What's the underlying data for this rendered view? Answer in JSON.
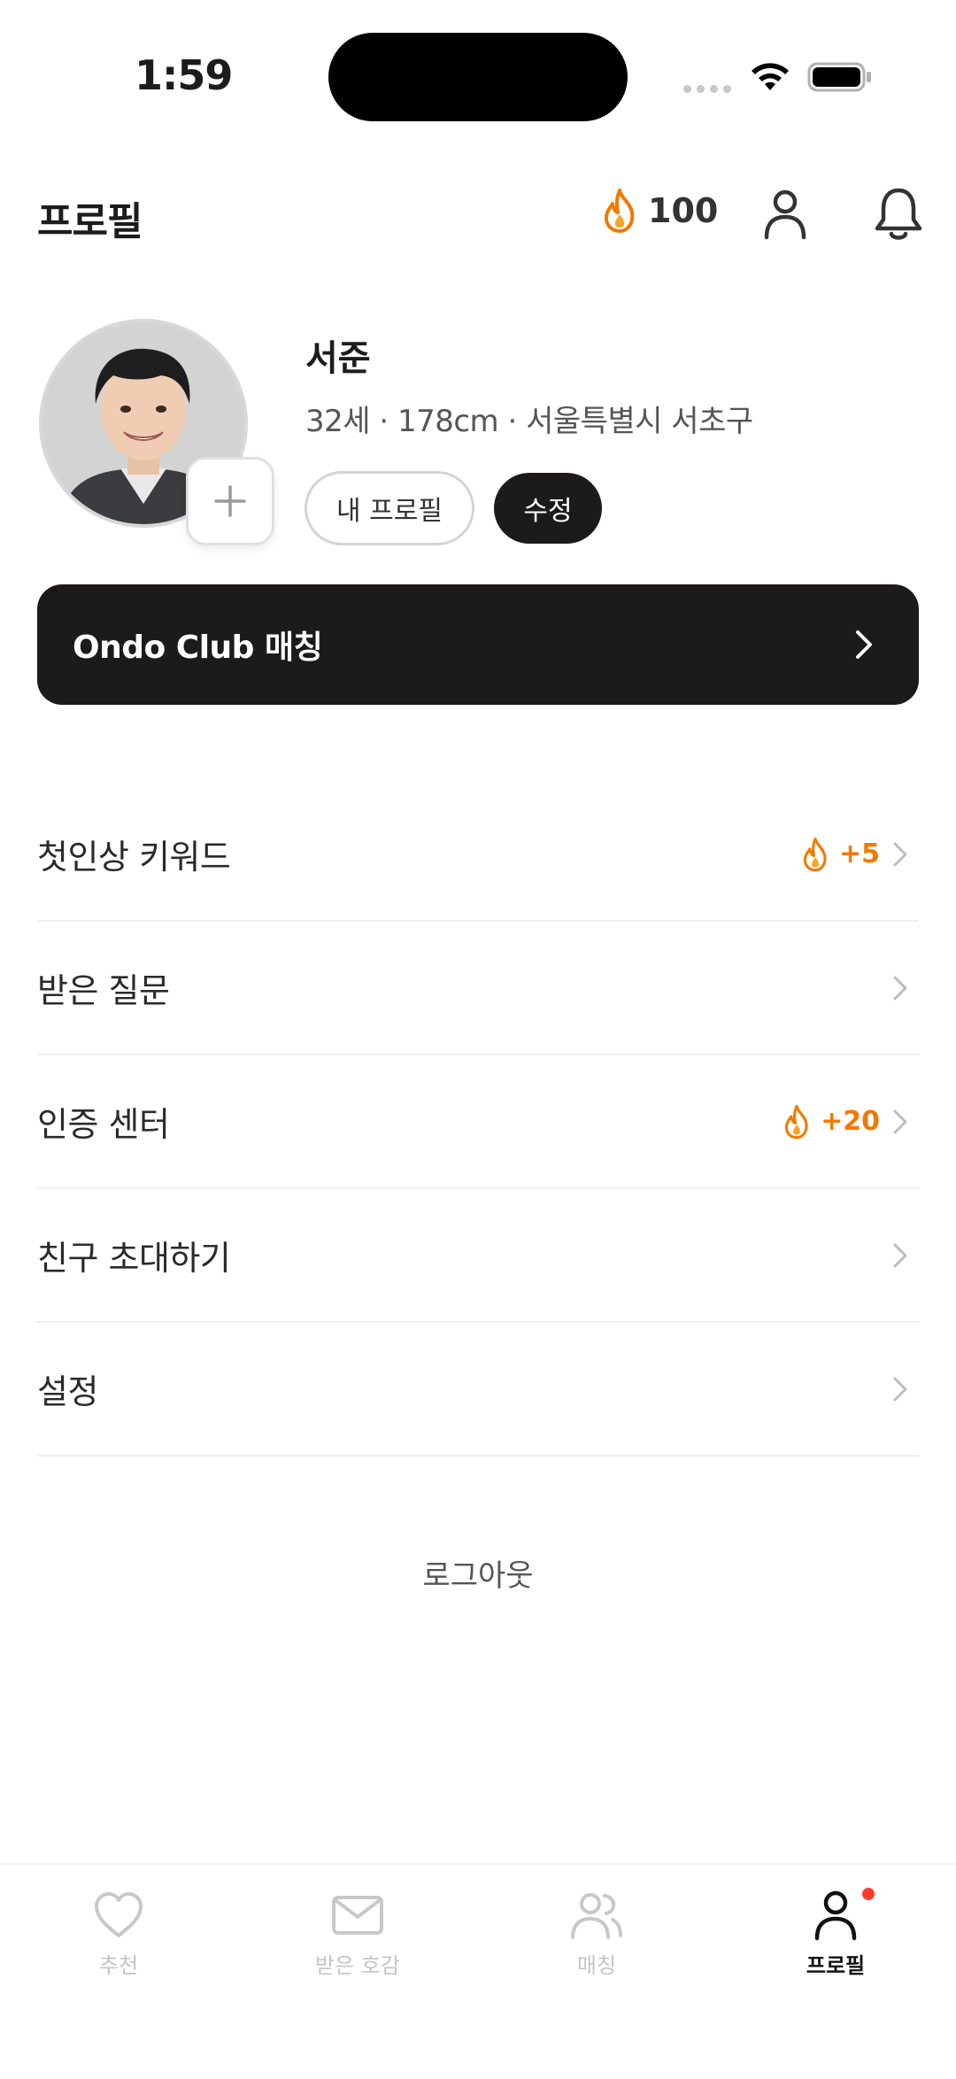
{
  "status_bar": {
    "time": "1:59"
  },
  "header": {
    "title": "프로필",
    "points": "100",
    "icons": [
      "flame-icon",
      "person-icon",
      "bell-icon"
    ]
  },
  "profile": {
    "name": "서준",
    "info": "32세 · 178cm · 서울특별시 서초구",
    "my_profile_button": "내 프로필",
    "edit_button": "수정"
  },
  "club_banner": {
    "label": "Ondo Club 매칭"
  },
  "menu": {
    "items": [
      {
        "label": "첫인상 키워드",
        "reward": "+5"
      },
      {
        "label": "받은 질문"
      },
      {
        "label": "인증 센터",
        "reward": "+20"
      },
      {
        "label": "친구 초대하기"
      },
      {
        "label": "설정"
      }
    ]
  },
  "logout": "로그아웃",
  "tab_bar": {
    "tabs": [
      {
        "label": "추천",
        "icon": "heart-icon"
      },
      {
        "label": "받은 호감",
        "icon": "mail-icon"
      },
      {
        "label": "매칭",
        "icon": "people-icon"
      },
      {
        "label": "프로필",
        "icon": "person-icon",
        "active": true
      }
    ]
  },
  "colors": {
    "accent": "#F07A00",
    "dark": "#1C1B1A",
    "badge": "#FF3B30"
  }
}
